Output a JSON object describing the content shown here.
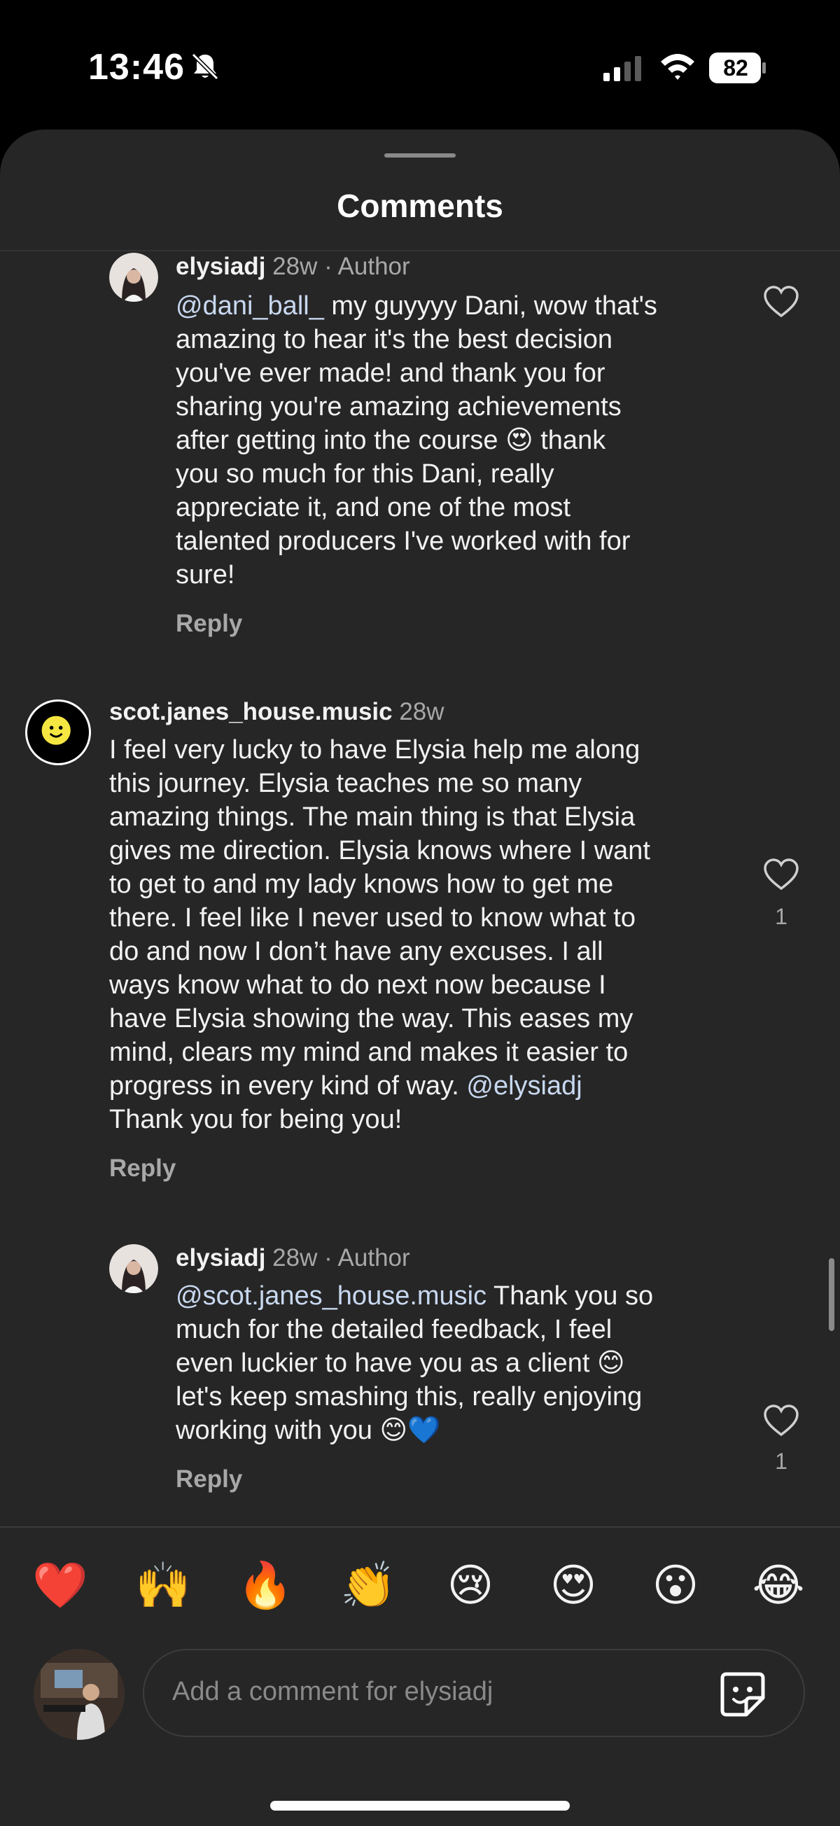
{
  "status_bar": {
    "time": "13:46",
    "battery": "82"
  },
  "sheet": {
    "title": "Comments"
  },
  "comments": [
    {
      "username": "elysiadj",
      "time_ago": "28w",
      "author_tag": "· Author",
      "mention": "@dani_ball_",
      "lines": [
        " my guyyyy Dani, wow that's",
        "amazing to hear it's the best decision",
        "you've ever made! and thank you for",
        "sharing you're amazing achievements",
        "after getting into the course 😍 thank",
        "you so much for this Dani, really",
        "appreciate it, and one of the most",
        "talented producers I've worked with for",
        "sure!"
      ],
      "reply_label": "Reply",
      "likes": ""
    },
    {
      "username": "scot.janes_house.music",
      "time_ago": "28w",
      "avatar_emoji": "🙂",
      "lines": [
        "I feel very lucky to have Elysia help me along",
        "this journey. Elysia teaches me so many",
        "amazing things. The main thing is that Elysia",
        "gives me direction. Elysia knows where I want",
        "to get to and my lady knows how to get me",
        "there. I feel like I never used to know what to",
        "do and now I don’t have any excuses. I all",
        "ways know what to do next now because I",
        "have Elysia showing the way. This eases my",
        "mind, clears my mind and makes it easier to",
        "progress in every kind of way. "
      ],
      "mention": "@elysiadj",
      "last_line": "Thank you for being you!",
      "reply_label": "Reply",
      "likes": "1"
    },
    {
      "username": "elysiadj",
      "time_ago": "28w",
      "author_tag": "· Author",
      "mention": "@scot.janes_house.music",
      "lines": [
        " Thank you so",
        "much for the detailed feedback, I feel",
        "even luckier to have you as a client 😊",
        "let's keep smashing this, really enjoying",
        "working with you 😊💙"
      ],
      "reply_label": "Reply",
      "likes": "1"
    }
  ],
  "quick_reactions": [
    "❤️",
    "🙌",
    "🔥",
    "👏",
    "😢",
    "😍",
    "😮",
    "😂"
  ],
  "composer": {
    "placeholder": "Add a comment for elysiadj"
  },
  "icons": {
    "bell": "bell-slash-icon",
    "signal": "signal-icon",
    "wifi": "wifi-icon",
    "battery": "battery-icon",
    "heart": "heart-outline-icon",
    "sticker": "sticker-icon"
  }
}
